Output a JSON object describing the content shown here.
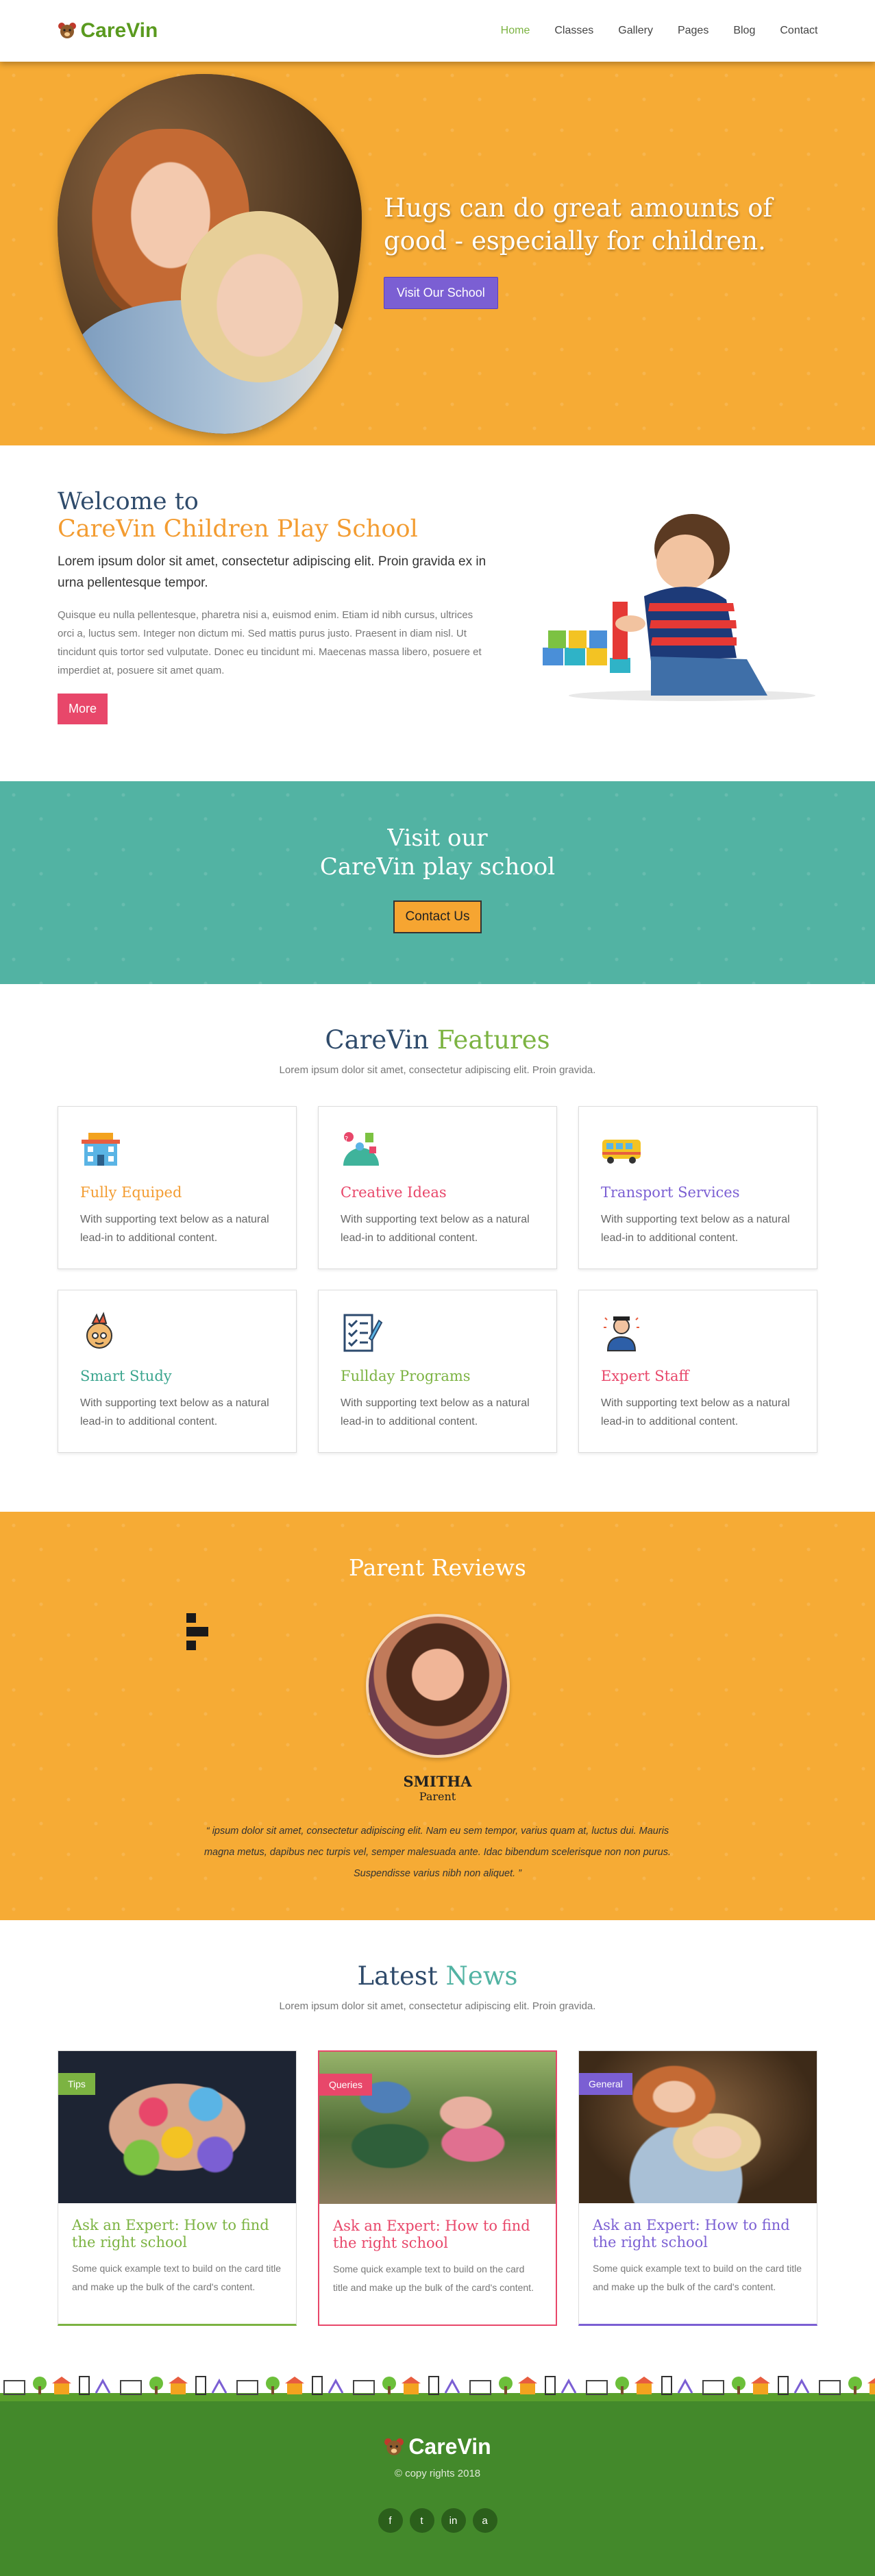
{
  "header": {
    "brand": "CareVin",
    "nav": [
      {
        "label": "Home",
        "active": true
      },
      {
        "label": "Classes"
      },
      {
        "label": "Gallery"
      },
      {
        "label": "Pages"
      },
      {
        "label": "Blog"
      },
      {
        "label": "Contact"
      }
    ]
  },
  "hero": {
    "title": "Hugs can do great amounts of good - especially for children.",
    "button": "Visit Our School"
  },
  "welcome": {
    "title_line1": "Welcome to",
    "title_line2": "CareVin Children Play School",
    "lead": "Lorem ipsum dolor sit amet, consectetur adipiscing elit. Proin gravida ex in urna pellentesque tempor.",
    "body": "Quisque eu nulla pellentesque, pharetra nisi a, euismod enim. Etiam id nibh cursus, ultrices orci a, luctus sem. Integer non dictum mi. Sed mattis purus justo. Praesent in diam nisl. Ut tincidunt quis tortor sed vulputate. Donec eu tincidunt mi. Maecenas massa libero, posuere et imperdiet at, posuere sit amet quam.",
    "button": "More"
  },
  "visit": {
    "line1": "Visit our",
    "line2": "CareVin play school",
    "button": "Contact Us"
  },
  "features": {
    "title_a": "CareVin",
    "title_b": "Features",
    "subtitle": "Lorem ipsum dolor sit amet, consectetur adipiscing elit. Proin gravida.",
    "items": [
      {
        "title": "Fully Equiped",
        "text": "With supporting text below as a natural lead-in to additional content.",
        "color": "#f39c31",
        "icon": "school-building-icon"
      },
      {
        "title": "Creative Ideas",
        "text": "With supporting text below as a natural lead-in to additional content.",
        "color": "#e8476a",
        "icon": "creative-ideas-icon"
      },
      {
        "title": "Transport Services",
        "text": "With supporting text below as a natural lead-in to additional content.",
        "color": "#7b5fd3",
        "icon": "school-bus-icon"
      },
      {
        "title": "Smart Study",
        "text": "With supporting text below as a natural lead-in to additional content.",
        "color": "#3aa58e",
        "icon": "smart-study-icon"
      },
      {
        "title": "Fullday Programs",
        "text": "With supporting text below as a natural lead-in to additional content.",
        "color": "#7cb342",
        "icon": "checklist-icon"
      },
      {
        "title": "Expert Staff",
        "text": "With supporting text below as a natural lead-in to additional content.",
        "color": "#e8476a",
        "icon": "expert-staff-icon"
      }
    ]
  },
  "reviews": {
    "title": "Parent Reviews",
    "name": "SMITHA",
    "role": "Parent",
    "quote": "ipsum dolor sit amet, consectetur adipiscing elit. Nam eu sem tempor, varius quam at, luctus dui. Mauris magna metus, dapibus nec turpis vel, semper malesuada ante. Idac bibendum scelerisque non non purus. Suspendisse varius nibh non aliquet."
  },
  "news": {
    "title_a": "Latest",
    "title_b": "News",
    "subtitle": "Lorem ipsum dolor sit amet, consectetur adipiscing elit. Proin gravida.",
    "items": [
      {
        "tag": "Tips",
        "title": "Ask an Expert: How to find the right school",
        "text": "Some quick example text to build on the card title and make up the bulk of the card's content.",
        "color": "#7cb342"
      },
      {
        "tag": "Queries",
        "title": "Ask an Expert: How to find the right school",
        "text": "Some quick example text to build on the card title and make up the bulk of the card's content.",
        "color": "#e8476a"
      },
      {
        "tag": "General",
        "title": "Ask an Expert: How to find the right school",
        "text": "Some quick example text to build on the card title and make up the bulk of the card's content.",
        "color": "#7b5fd3"
      }
    ]
  },
  "footer": {
    "brand": "CareVin",
    "copyright": "© copy rights 2018",
    "social": [
      "f",
      "t",
      "in",
      "a"
    ]
  },
  "colors": {
    "orange": "#f6ab35",
    "teal": "#52b3a3",
    "green": "#43892b",
    "purple": "#7b5fd3",
    "red": "#e8476a",
    "navy": "#2f4b6b"
  }
}
